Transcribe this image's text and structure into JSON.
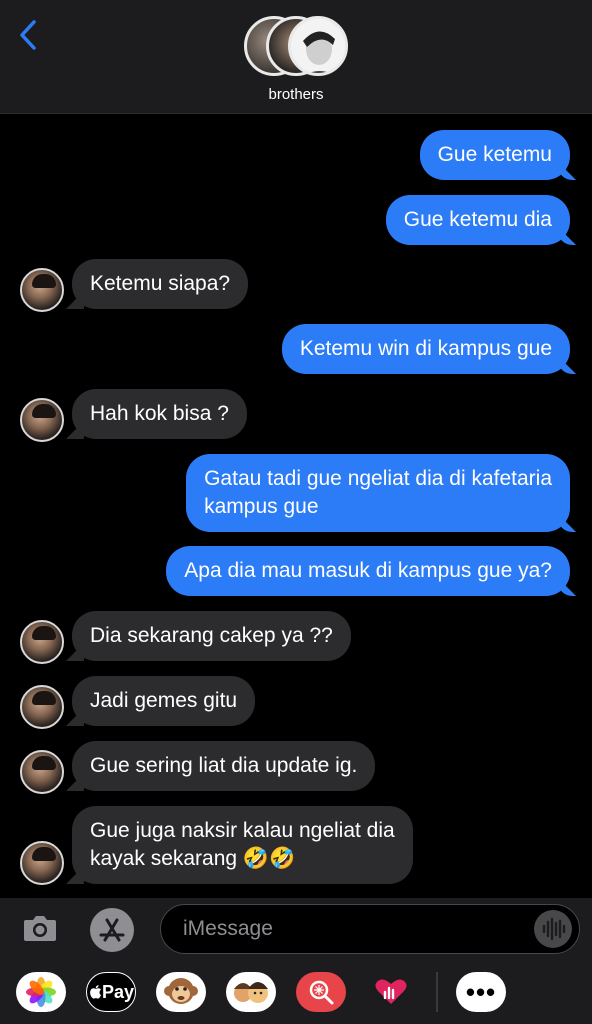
{
  "header": {
    "group_name": "brothers"
  },
  "messages": [
    {
      "side": "sent",
      "text": "Gue ketemu"
    },
    {
      "side": "sent",
      "text": "Gue ketemu dia"
    },
    {
      "side": "received",
      "text": "Ketemu siapa?"
    },
    {
      "side": "sent",
      "text": "Ketemu win di kampus gue"
    },
    {
      "side": "received",
      "text": "Hah kok bisa ?"
    },
    {
      "side": "sent",
      "lines": [
        "Gatau tadi gue ngeliat dia di kafetaria",
        "kampus gue"
      ]
    },
    {
      "side": "sent",
      "text": "Apa dia mau masuk di kampus gue ya?"
    },
    {
      "side": "received",
      "text": "Dia sekarang cakep ya ??"
    },
    {
      "side": "received",
      "text": "Jadi gemes gitu"
    },
    {
      "side": "received",
      "text": "Gue sering liat dia update ig."
    },
    {
      "side": "received",
      "lines": [
        "Gue juga naksir kalau ngeliat dia",
        "kayak sekarang 🤣🤣"
      ]
    }
  ],
  "composer": {
    "placeholder": "iMessage"
  },
  "app_drawer": {
    "apple_pay_label": "Pay",
    "more_label": "•••"
  },
  "icons": {
    "back": "chevron-left-icon",
    "camera": "camera-icon",
    "app_store": "app-store-icon",
    "audio": "waveform-icon",
    "photos": "photos-icon",
    "memoji": "memoji-icon",
    "monkey": "monkey-animoji-icon",
    "search": "images-search-icon",
    "digital_touch": "digital-touch-icon"
  },
  "colors": {
    "accent": "#2b7cf6",
    "sent_bubble": "#2b7cf6",
    "received_bubble": "#2c2c2e",
    "background": "#000000"
  }
}
